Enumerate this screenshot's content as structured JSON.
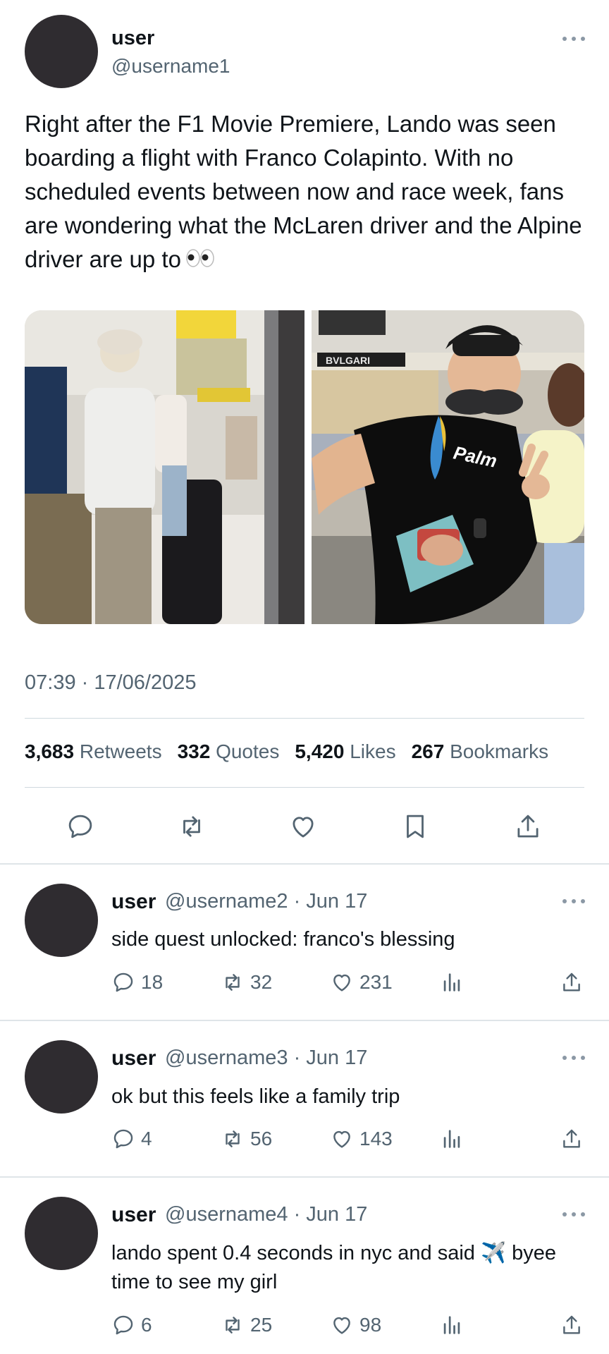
{
  "main_tweet": {
    "user_name": "user",
    "handle": "@username1",
    "text": "Right after the F1 Movie Premiere, Lando was seen boarding a flight with Franco Colapinto. With no scheduled events between now and race week, fans are wondering what the McLaren driver and the Alpine driver are up to",
    "emoji": "👀",
    "timestamp": "07:39 · 17/06/2025",
    "stats": [
      {
        "count": "3,683",
        "label": "Retweets"
      },
      {
        "count": "332",
        "label": "Quotes"
      },
      {
        "count": "5,420",
        "label": "Likes"
      },
      {
        "count": "267",
        "label": "Bookmarks"
      }
    ],
    "actions": [
      "reply-icon",
      "retweet-icon",
      "like-icon",
      "bookmark-icon",
      "share-icon"
    ],
    "photo_text": {
      "store_sign": "BVLGARI",
      "shirt_text": "Palm"
    }
  },
  "replies": [
    {
      "user_name": "user",
      "meta": "@username2 · Jun 17",
      "text": "side quest unlocked: franco's blessing",
      "replies": "18",
      "retweets": "32",
      "likes": "231"
    },
    {
      "user_name": "user",
      "meta": "@username3 · Jun 17",
      "text": "ok but this feels like a family trip",
      "replies": "4",
      "retweets": "56",
      "likes": "143"
    },
    {
      "user_name": "user",
      "meta": "@username4 · Jun 17",
      "text_line1": "lando spent 0.4 seconds in nyc and said",
      "text_emoji": "✈️",
      "text_after": "byee",
      "text_line2": "time to see my girl",
      "replies": "6",
      "retweets": "25",
      "likes": "98"
    }
  ],
  "colors": {
    "text": "#0f1419",
    "secondary": "#536471",
    "divider": "#cfd9de",
    "avatar": "#2f2c30"
  }
}
